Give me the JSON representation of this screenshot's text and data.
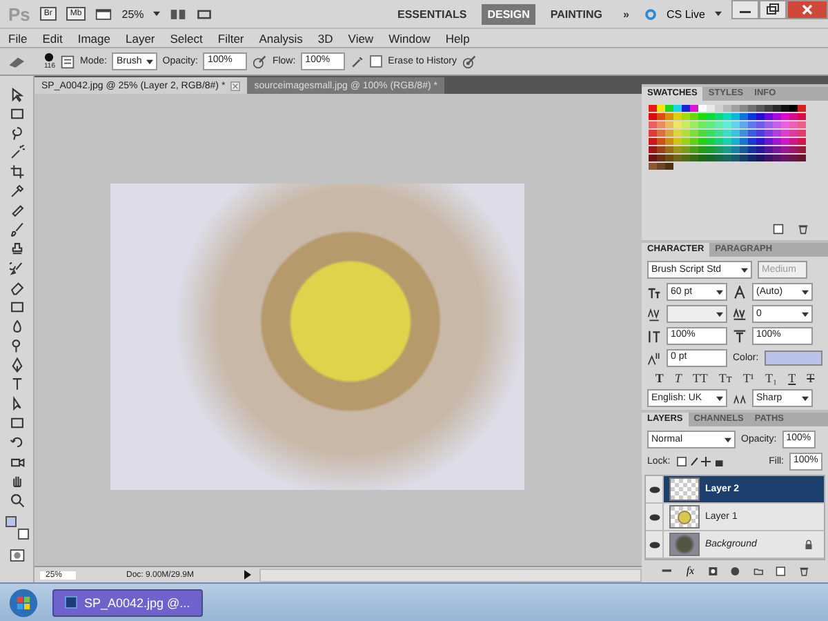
{
  "app": {
    "logo": "Ps",
    "bridge": "Br",
    "mini_bridge": "Mb",
    "zoom": "25%",
    "more": "»",
    "cs_live": "CS Live",
    "workspaces": [
      {
        "label": "ESSENTIALS",
        "selected": false
      },
      {
        "label": "DESIGN",
        "selected": true
      },
      {
        "label": "PAINTING",
        "selected": false
      }
    ]
  },
  "menu": [
    "File",
    "Edit",
    "Image",
    "Layer",
    "Select",
    "Filter",
    "Analysis",
    "3D",
    "View",
    "Window",
    "Help"
  ],
  "options": {
    "brush_size": "116",
    "mode_label": "Mode:",
    "mode": "Brush",
    "opacity_label": "Opacity:",
    "opacity": "100%",
    "flow_label": "Flow:",
    "flow": "100%",
    "erase_to_history": {
      "label": "Erase to History",
      "checked": false
    }
  },
  "documents": [
    {
      "label": "SP_A0042.jpg @ 25% (Layer 2, RGB/8#) *",
      "selected": true
    },
    {
      "label": "sourceimagesmall.jpg @ 100% (RGB/8#) *",
      "selected": false
    }
  ],
  "tool_colors": [
    {
      "kind": "foreground",
      "color": "#b8c2ea"
    },
    {
      "kind": "background",
      "color": "#ffffff"
    }
  ],
  "swatches": {
    "tabs": [
      {
        "label": "SWATCHES",
        "selected": true
      },
      {
        "label": "STYLES",
        "selected": false
      },
      {
        "label": "INFO",
        "selected": false
      }
    ]
  },
  "character": {
    "tabs": [
      {
        "label": "CHARACTER",
        "selected": true
      },
      {
        "label": "PARAGRAPH",
        "selected": false
      }
    ],
    "font": "Brush Script Std",
    "style": "Medium",
    "size": "60 pt",
    "leading": "(Auto)",
    "tracking": "0",
    "vertical_scale": "100%",
    "horizontal_scale": "100%",
    "baseline": "0 pt",
    "color_label": "Color:",
    "color": "#b8c2ea",
    "type_styles": [
      {
        "kind": "bold",
        "label": "T"
      },
      {
        "kind": "italic",
        "label": "T"
      },
      {
        "kind": "caps",
        "label": "TT"
      },
      {
        "kind": "smallcaps",
        "label": "Tт"
      },
      {
        "kind": "super",
        "label": "T¹"
      },
      {
        "kind": "sub",
        "label": "T₁"
      },
      {
        "kind": "underline",
        "label": "T"
      },
      {
        "kind": "strike",
        "label": "T"
      }
    ],
    "language": "English: UK",
    "antialias": "Sharp"
  },
  "layers": {
    "tabs": [
      {
        "label": "LAYERS",
        "selected": true
      },
      {
        "label": "CHANNELS",
        "selected": false
      },
      {
        "label": "PATHS",
        "selected": false
      }
    ],
    "blend": "Normal",
    "opacity_label": "Opacity:",
    "opacity": "100%",
    "lock_label": "Lock:",
    "fill_label": "Fill:",
    "fill": "100%",
    "fx": "fx",
    "items": [
      {
        "name": "Layer 2",
        "kind": "transparent",
        "selected": true,
        "visible": true,
        "locked": false
      },
      {
        "name": "Layer 1",
        "kind": "watch",
        "selected": false,
        "visible": true,
        "locked": false
      },
      {
        "name": "Background",
        "kind": "photo",
        "selected": false,
        "visible": true,
        "locked": true
      }
    ]
  },
  "status": {
    "zoom": "25%",
    "doc": "Doc: 9.00M/29.9M"
  },
  "taskbar": {
    "task": "SP_A0042.jpg @..."
  }
}
